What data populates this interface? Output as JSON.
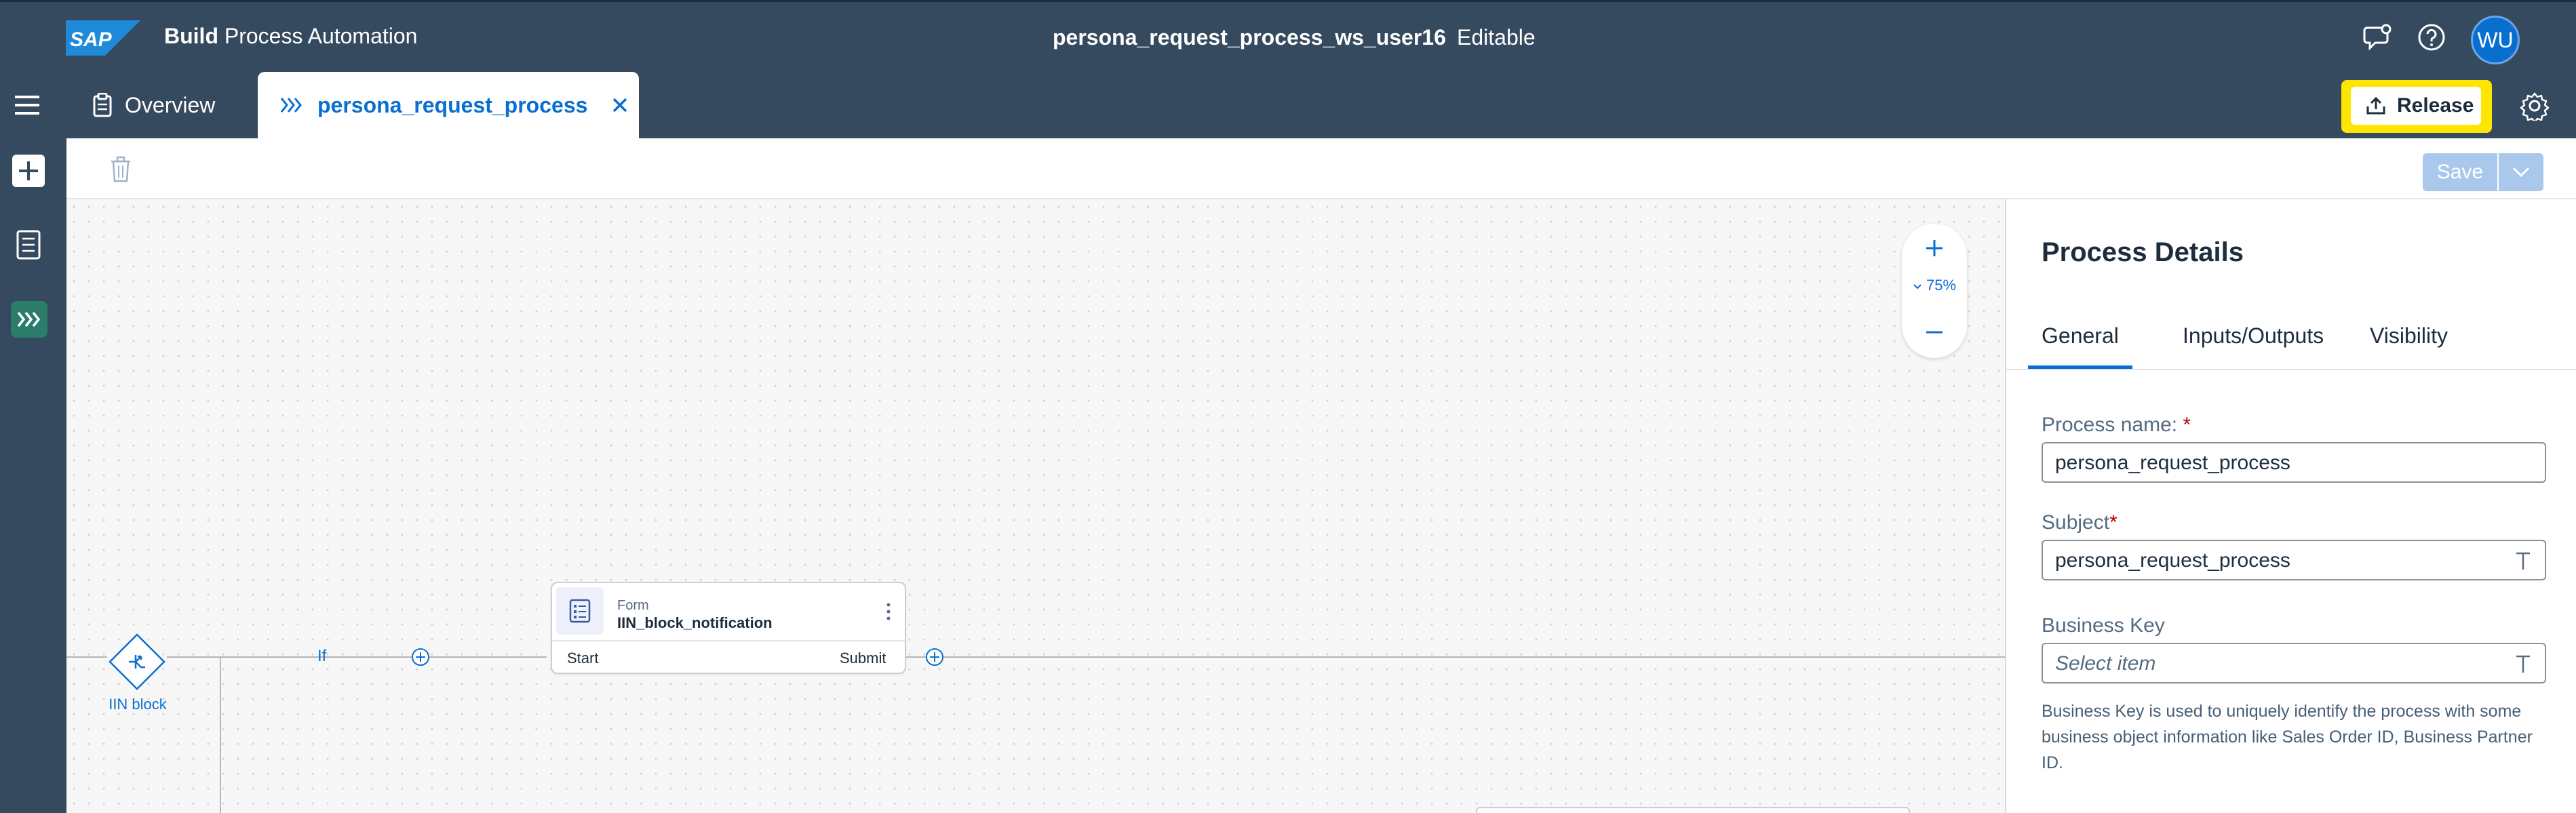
{
  "header": {
    "logo_text": "SAP",
    "product_bold": "Build",
    "product_rest": " Process Automation",
    "project_name": "persona_request_process_ws_user16",
    "project_status": "Editable",
    "avatar_initials": "WU",
    "icons": [
      "feedback-icon",
      "help-icon"
    ]
  },
  "tabs": {
    "overview_label": "Overview",
    "active_label": "persona_request_process",
    "release_label": "Release"
  },
  "toolbar": {
    "save_label": "Save"
  },
  "canvas": {
    "zoom_level": "75%",
    "gateway_label": "IIN block",
    "branch_label": "If",
    "form_node": {
      "type": "Form",
      "name": "IIN_block_notification",
      "start_label": "Start",
      "submit_label": "Submit"
    }
  },
  "panel": {
    "title": "Process Details",
    "tabs": [
      "General",
      "Inputs/Outputs",
      "Visibility"
    ],
    "active_tab": "General",
    "process_name_label": "Process name:",
    "process_name_value": "persona_request_process",
    "subject_label": "Subject",
    "subject_value": "persona_request_process",
    "business_key_label": "Business Key",
    "business_key_placeholder": "Select item",
    "business_key_help": "Business Key is used to uniquely identify the process with some business object information like Sales Order ID, Business Partner ID."
  },
  "colors": {
    "shell": "#354a5f",
    "accent": "#0a6ed1",
    "highlight": "#ffe600",
    "active_rail": "#2b7c6b"
  }
}
